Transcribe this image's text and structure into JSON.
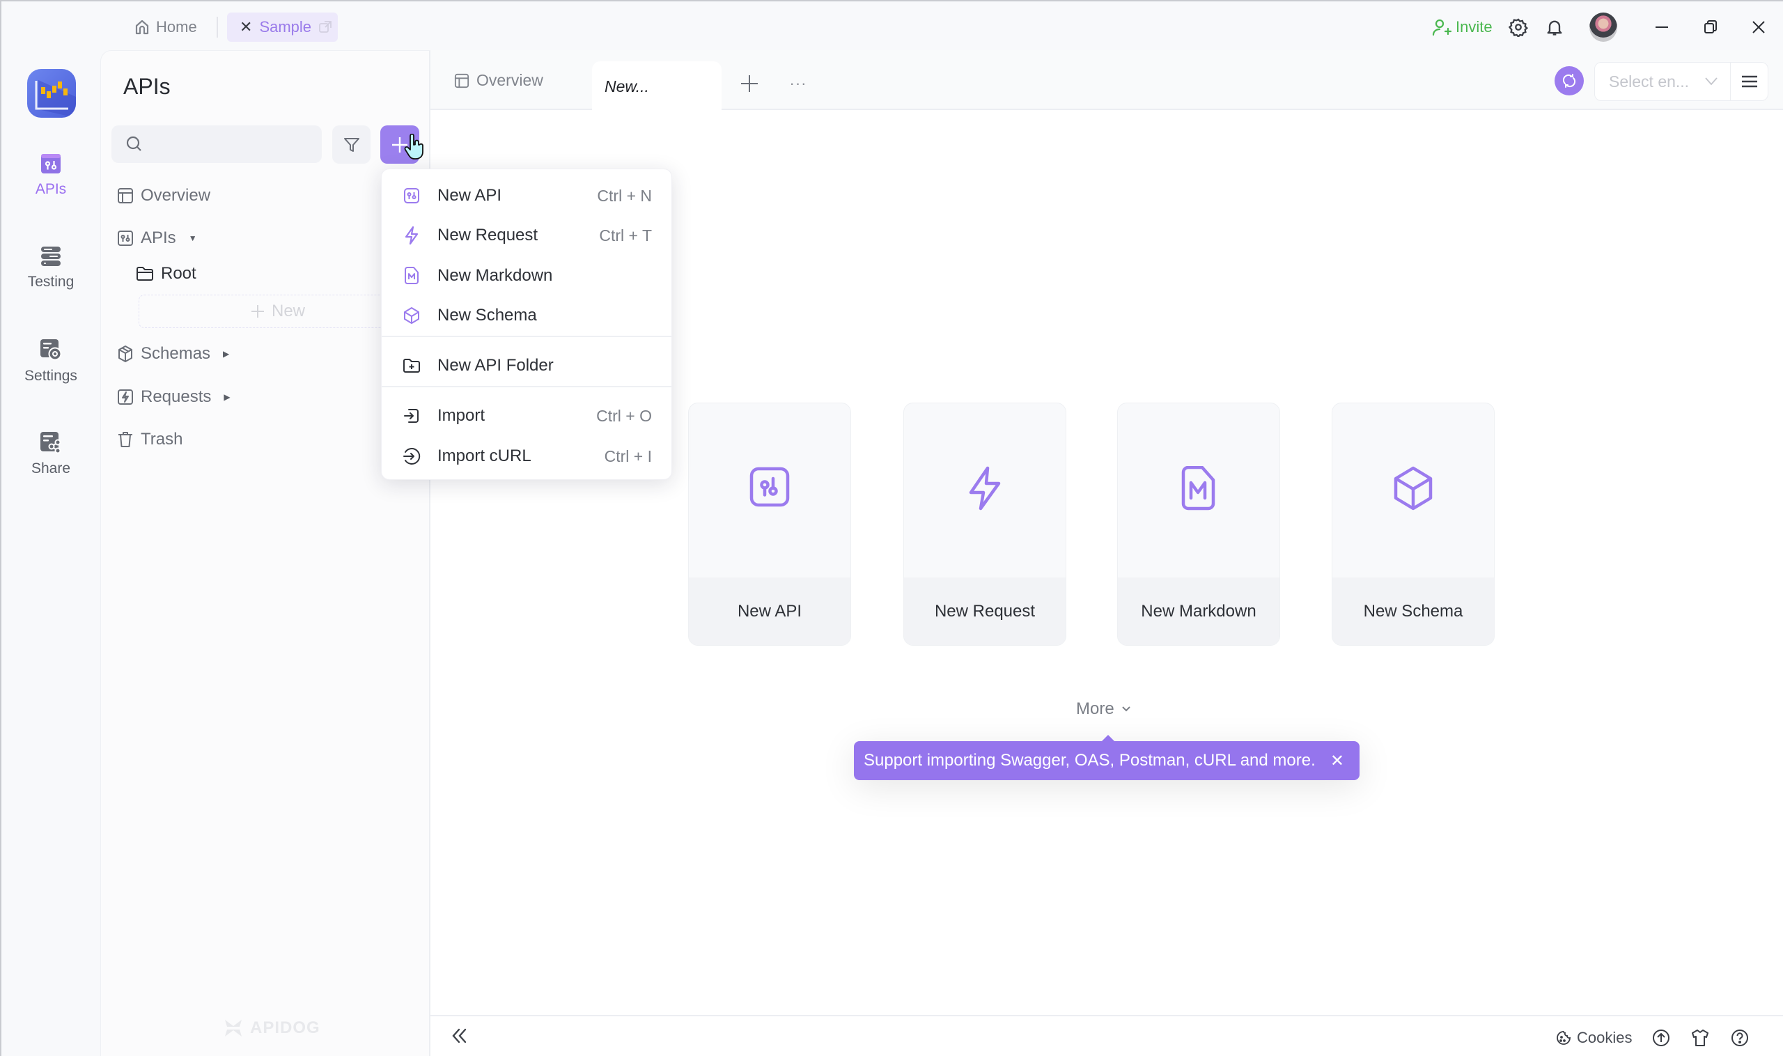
{
  "titlebar": {
    "home_label": "Home",
    "project_tab_label": "Sample",
    "invite_label": "Invite"
  },
  "rail": {
    "items": [
      {
        "label": "APIs",
        "icon": "api-icon",
        "active": true
      },
      {
        "label": "Testing",
        "icon": "testing-icon",
        "active": false
      },
      {
        "label": "Settings",
        "icon": "settings-icon",
        "active": false
      },
      {
        "label": "Share",
        "icon": "share-icon",
        "active": false
      }
    ]
  },
  "panel": {
    "title": "APIs",
    "search_placeholder": "",
    "nav": [
      {
        "label": "Overview",
        "icon": "overview-icon"
      },
      {
        "label": "APIs",
        "icon": "api-icon",
        "caret": "down"
      },
      {
        "label": "Root",
        "icon": "folder-icon",
        "indent": 1
      },
      {
        "label": "Schemas",
        "icon": "schema-icon",
        "caret": "right"
      },
      {
        "label": "Requests",
        "icon": "request-icon",
        "caret": "right"
      },
      {
        "label": "Trash",
        "icon": "trash-icon"
      }
    ],
    "new_label": "New",
    "watermark": "APIDOG"
  },
  "main": {
    "tabs": [
      {
        "label": "Overview",
        "active": false
      },
      {
        "label": "New...",
        "active": true
      }
    ],
    "env_select_placeholder": "Select en...",
    "cards": [
      {
        "label": "New API",
        "icon": "api-icon"
      },
      {
        "label": "New Request",
        "icon": "lightning-icon"
      },
      {
        "label": "New Markdown",
        "icon": "markdown-icon"
      },
      {
        "label": "New Schema",
        "icon": "cube-icon"
      }
    ],
    "more_label": "More",
    "tooltip_text": "Support importing Swagger, OAS, Postman, cURL and more."
  },
  "dropdown": {
    "items": [
      {
        "label": "New API",
        "shortcut": "Ctrl + N",
        "icon": "api-icon"
      },
      {
        "label": "New Request",
        "shortcut": "Ctrl + T",
        "icon": "lightning-icon"
      },
      {
        "label": "New Markdown",
        "shortcut": "",
        "icon": "markdown-icon"
      },
      {
        "label": "New Schema",
        "shortcut": "",
        "icon": "cube-icon"
      },
      {
        "label": "New API Folder",
        "shortcut": "",
        "icon": "folder-plus-icon"
      },
      {
        "label": "Import",
        "shortcut": "Ctrl + O",
        "icon": "import-icon"
      },
      {
        "label": "Import cURL",
        "shortcut": "Ctrl + I",
        "icon": "import-curl-icon"
      }
    ]
  },
  "statusbar": {
    "cookies_label": "Cookies"
  },
  "colors": {
    "accent": "#9b7bee",
    "invite": "#4ab74f",
    "tooltip_bg": "#9575ed"
  }
}
